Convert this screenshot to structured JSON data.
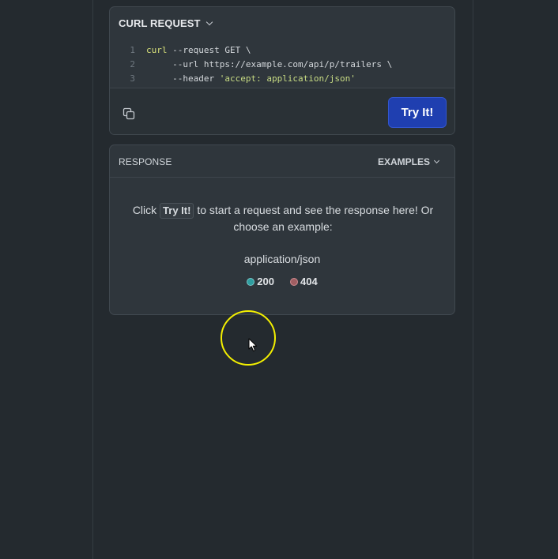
{
  "curl": {
    "title": "CURL REQUEST",
    "lines": [
      {
        "number": "1",
        "parts": [
          {
            "t": "curl",
            "c": "tok-cmd"
          },
          {
            "t": " --request GET \\",
            "c": "tok-plain"
          }
        ]
      },
      {
        "number": "2",
        "parts": [
          {
            "t": "     --url https://example.com/api/p/trailers \\",
            "c": "tok-plain"
          }
        ]
      },
      {
        "number": "3",
        "parts": [
          {
            "t": "     --header ",
            "c": "tok-plain"
          },
          {
            "t": "'accept: application/json'",
            "c": "tok-str"
          }
        ]
      }
    ],
    "try_label": "Try It!"
  },
  "response": {
    "title": "RESPONSE",
    "examples_label": "EXAMPLES",
    "message_before": "Click ",
    "message_kbd": "Try It!",
    "message_after": " to start a request and see the response here! Or choose an example:",
    "media_type": "application/json",
    "codes": [
      {
        "label": "200",
        "status": "ok"
      },
      {
        "label": "404",
        "status": "err"
      }
    ]
  },
  "colors": {
    "background": "#242a2f",
    "card": "#2f363c",
    "accent_button": "#1f3fb0",
    "status_ok": "#2f9ea0",
    "status_err": "#a05e62",
    "cursor_highlight": "#f4f000"
  },
  "icons": {
    "copy": "copy-icon",
    "chevron": "chevron-down-icon",
    "cursor": "mouse-cursor-icon"
  }
}
